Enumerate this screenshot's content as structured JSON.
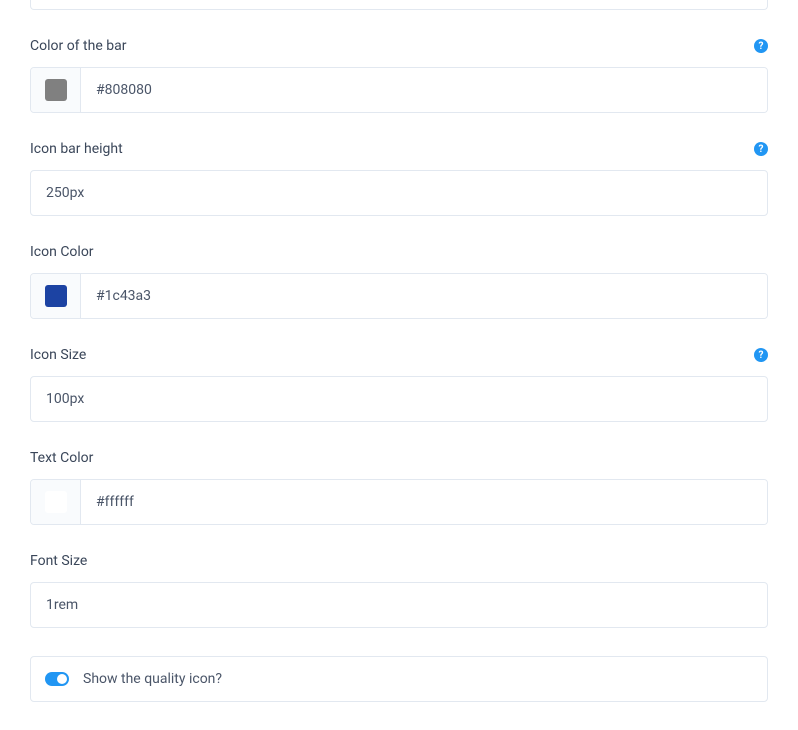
{
  "fields": {
    "bar_color": {
      "label": "Color of the bar",
      "value": "#808080",
      "swatch": "#808080",
      "has_help": true
    },
    "icon_bar_height": {
      "label": "Icon bar height",
      "value": "250px",
      "has_help": true
    },
    "icon_color": {
      "label": "Icon Color",
      "value": "#1c43a3",
      "swatch": "#1c43a3",
      "has_help": false
    },
    "icon_size": {
      "label": "Icon Size",
      "value": "100px",
      "has_help": true
    },
    "text_color": {
      "label": "Text Color",
      "value": "#ffffff",
      "swatch": "#ffffff",
      "has_help": false
    },
    "font_size": {
      "label": "Font Size",
      "value": "1rem",
      "has_help": false
    },
    "show_quality_icon": {
      "label": "Show the quality icon?",
      "enabled": true
    }
  },
  "help_glyph": "?"
}
